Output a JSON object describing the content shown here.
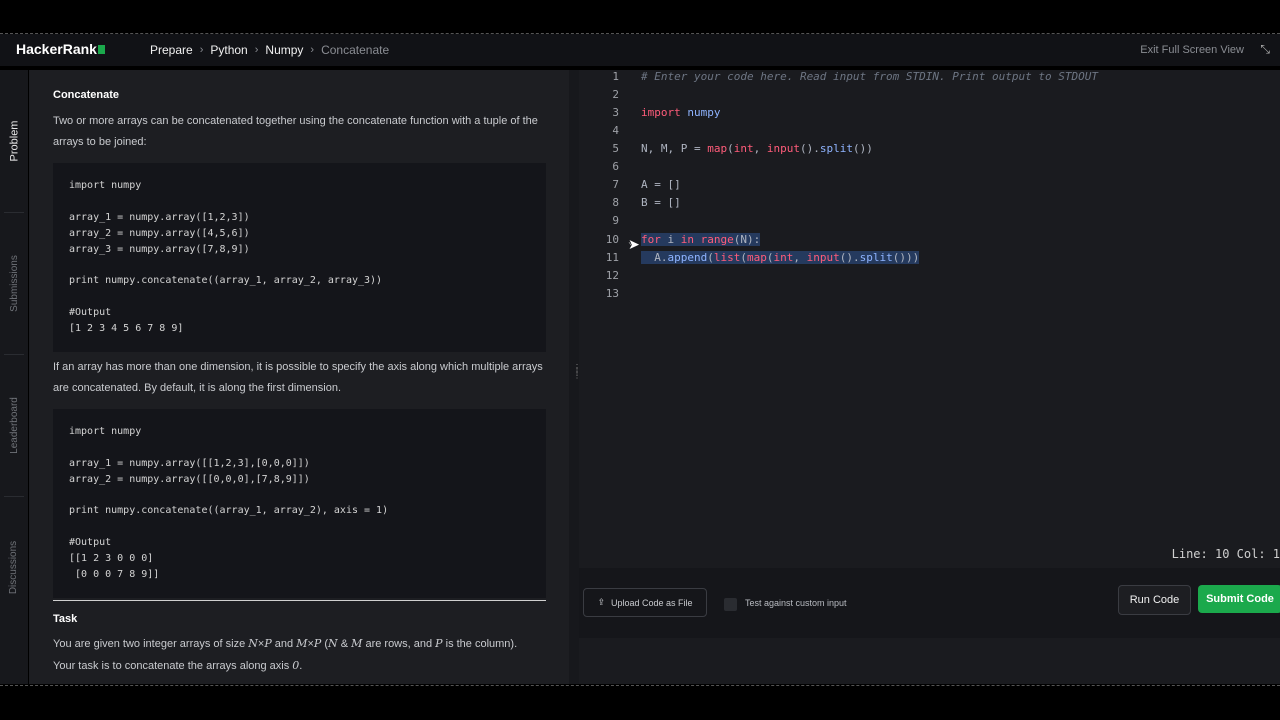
{
  "app": {
    "logo": "HackerRank"
  },
  "breadcrumbs": [
    "Prepare",
    "Python",
    "Numpy",
    "Concatenate"
  ],
  "header": {
    "exit_label": "Exit Full Screen View"
  },
  "side_tabs": [
    "Problem",
    "Submissions",
    "Leaderboard",
    "Discussions"
  ],
  "problem": {
    "title": "Concatenate",
    "intro": "Two or more arrays can be concatenated together using the concatenate function with a tuple of the arrays to be joined:",
    "code1": [
      "import numpy",
      "",
      "array_1 = numpy.array([1,2,3])",
      "array_2 = numpy.array([4,5,6])",
      "array_3 = numpy.array([7,8,9])",
      "",
      "print numpy.concatenate((array_1, array_2, array_3))",
      "",
      "#Output",
      "[1 2 3 4 5 6 7 8 9]"
    ],
    "para2": "If an array has more than one dimension, it is possible to specify the axis along which multiple arrays are concatenated. By default, it is along the first dimension.",
    "code2": [
      "import numpy",
      "",
      "array_1 = numpy.array([[1,2,3],[0,0,0]])",
      "array_2 = numpy.array([[0,0,0],[7,8,9]])",
      "",
      "print numpy.concatenate((array_1, array_2), axis = 1)",
      "",
      "#Output",
      "[[1 2 3 0 0 0]",
      " [0 0 0 7 8 9]]"
    ],
    "task_title": "Task",
    "task_l1a": "You are given two integer arrays of size ",
    "N": "N",
    "times": "×",
    "P": "P",
    "and": " and ",
    "M": "M",
    "paren_open": " (",
    "amp": " & ",
    "rows_text": " are rows, and ",
    "col_text": " is the column).",
    "task_l2a": "Your task is to concatenate the arrays along axis ",
    "zero": "0",
    "dot": "."
  },
  "editor": {
    "line_numbers": [
      "1",
      "2",
      "3",
      "4",
      "5",
      "6",
      "7",
      "8",
      "9",
      "10",
      "11",
      "12",
      "13"
    ],
    "l1": "# Enter your code here. Read input from STDIN. Print output to STDOUT",
    "l3_kw": "import",
    "l3_mod": " numpy",
    "l5_a": "N, M, P = ",
    "l5_map": "map",
    "l5_b": "(",
    "l5_int": "int",
    "l5_c": ", ",
    "l5_input": "input",
    "l5_d": "().",
    "l5_split": "split",
    "l5_e": "())",
    "l7": "A = []",
    "l8": "B = []",
    "l10_for": "for",
    "l10_i": " i ",
    "l10_in": "in",
    "l10_sp": " ",
    "l10_range": "range",
    "l10_end": "(N):",
    "l11_a": "  A.",
    "l11_append": "append",
    "l11_b": "(",
    "l11_list": "list",
    "l11_c": "(",
    "l11_map": "map",
    "l11_d": "(",
    "l11_int": "int",
    "l11_e": ", ",
    "l11_input": "input",
    "l11_f": "().",
    "l11_split": "split",
    "l11_g": "()))",
    "status": "Line: 10 Col: 1"
  },
  "actions": {
    "upload_label": "Upload Code as File",
    "custom_input_label": "Test against custom input",
    "run_label": "Run Code",
    "submit_label": "Submit Code"
  },
  "colors": {
    "accent": "#1ba94c",
    "keyword": "#ff5c7a",
    "function": "#8fb4ff"
  }
}
